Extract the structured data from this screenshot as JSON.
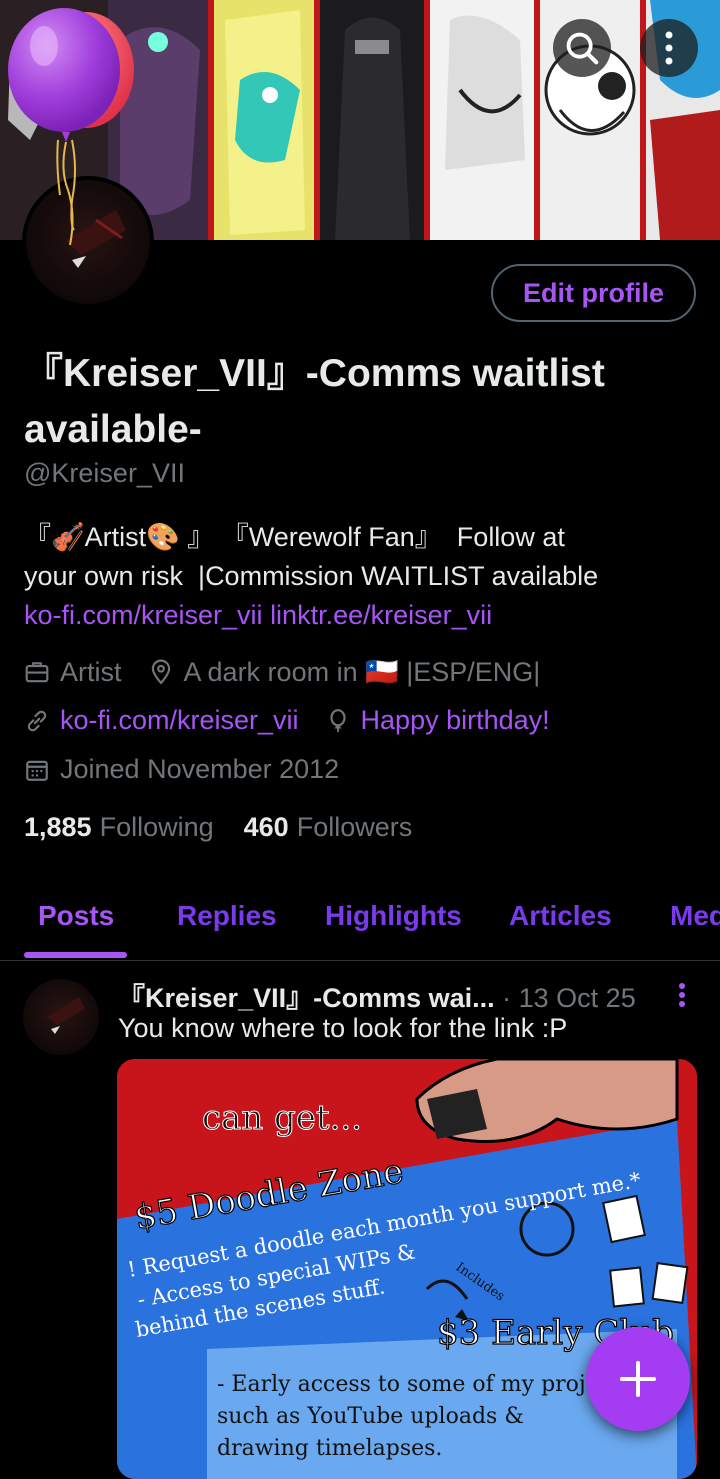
{
  "header": {
    "search_icon": "search-icon",
    "more_icon": "more-vertical-icon"
  },
  "profile": {
    "edit_label": "Edit profile",
    "display_name_line1": "『Kreiser_VII』-Comms waitlist",
    "display_name_line2": "available-",
    "handle": "@Kreiser_VII",
    "bio_line1": "『🎻Artist🎨 』 『Werewolf Fan』  Follow at",
    "bio_line2": "your own risk  |Commission WAITLIST available",
    "bio_link1": "ko-fi.com/kreiser_vii",
    "bio_link2": "linktr.ee/kreiser_vii",
    "category": "Artist",
    "location": "A dark room in 🇨🇱 |ESP/ENG|",
    "website": "ko-fi.com/kreiser_vii",
    "birthday": "Happy birthday!",
    "joined": "Joined November 2012",
    "following_count": "1,885",
    "following_label": "Following",
    "followers_count": "460",
    "followers_label": "Followers"
  },
  "tabs": [
    {
      "label": "Posts"
    },
    {
      "label": "Replies"
    },
    {
      "label": "Highlights"
    },
    {
      "label": "Articles"
    },
    {
      "label": "Media"
    }
  ],
  "post": {
    "author": "『Kreiser_VII』-Comms wai...",
    "date": "· 13 Oct 25",
    "text": "You know where to look for the link :P",
    "image": {
      "line_can_get": "can get...",
      "tier1_title": "$5 Doodle Zone",
      "tier1_l1": "! Request a doodle each month you support me.*",
      "tier1_l2": "- Access to special WIPs &",
      "tier1_l3": "behind the scenes stuff.",
      "includes": "Includes",
      "tier2_title": "$3 Early Club",
      "tier2_l1": "- Early access to some of my projects",
      "tier2_l2": "such as YouTube uploads &",
      "tier2_l3": "drawing timelapses."
    }
  },
  "fab": {
    "icon": "plus-icon"
  },
  "colors": {
    "accent": "#a855f7",
    "tab_inactive": "#7c3aed",
    "muted": "#71767b",
    "background": "#000000"
  }
}
